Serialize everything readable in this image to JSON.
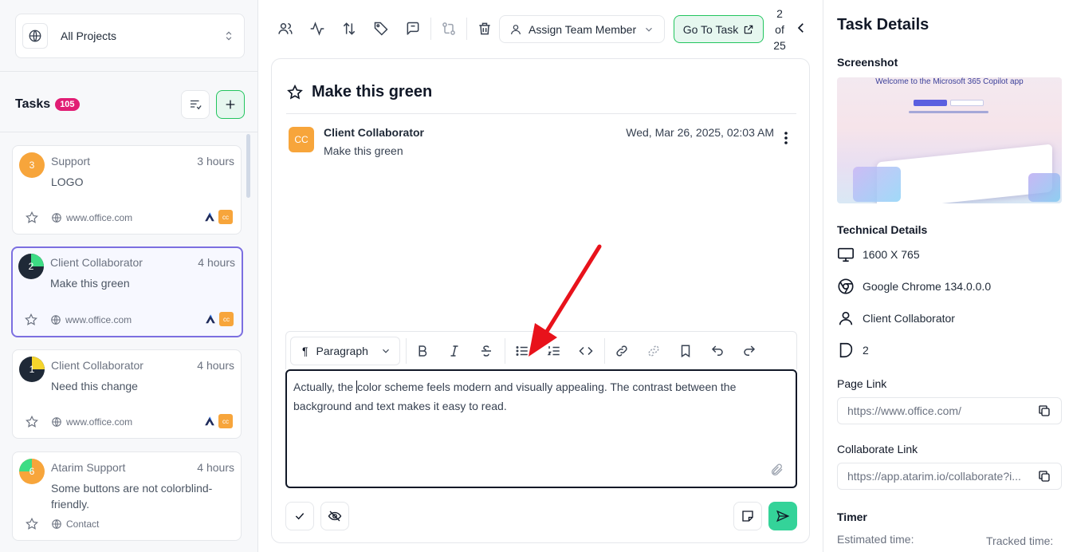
{
  "sidebar": {
    "project_select": "All Projects",
    "tasks_title": "Tasks",
    "tasks_count": "105",
    "tasks": [
      {
        "num": "3",
        "author": "Support",
        "time": "3 hours",
        "text": "LOGO",
        "site": "www.office.com"
      },
      {
        "num": "2",
        "author": "Client Collaborator",
        "time": "4 hours",
        "text": "Make this green",
        "site": "www.office.com"
      },
      {
        "num": "1",
        "author": "Client Collaborator",
        "time": "4 hours",
        "text": "Need this change",
        "site": "www.office.com"
      },
      {
        "num": "6",
        "author": "Atarim Support",
        "time": "4 hours",
        "text": "Some buttons are not colorblind-friendly.",
        "site": "Contact"
      }
    ],
    "avatar_initials": "cc"
  },
  "toolbar": {
    "assign_label": "Assign Team Member",
    "goto_label": "Go To Task",
    "pager": [
      "2",
      "of",
      "25"
    ]
  },
  "task": {
    "title": "Make this green",
    "comment": {
      "avatar": "CC",
      "author": "Client Collaborator",
      "date": "Wed, Mar 26, 2025, 02:03 AM",
      "text": "Make this green"
    },
    "editor": {
      "block_type": "Paragraph",
      "text_before_caret": "Actually, the ",
      "text_after_caret": "color scheme feels modern and visually appealing. The contrast between the background and text makes it easy to read."
    }
  },
  "details": {
    "title": "Task Details",
    "screenshot_label": "Screenshot",
    "screenshot_caption": "Welcome to the Microsoft 365 Copilot app",
    "technical_label": "Technical Details",
    "resolution": "1600 X 765",
    "browser": "Google Chrome 134.0.0.0",
    "user": "Client Collaborator",
    "task_number": "2",
    "page_link_label": "Page Link",
    "page_link": "https://www.office.com/",
    "collab_link_label": "Collaborate Link",
    "collab_link": "https://app.atarim.io/collaborate?i...",
    "timer_label": "Timer",
    "estimated_label": "Estimated time:",
    "tracked_label": "Tracked time:"
  },
  "colors": {
    "accent_green": "#22c55e",
    "badge_pink": "#e11d74",
    "avatar_orange": "#f7a53b",
    "selected_border": "#7c6fe0",
    "arrow_red": "#e8121b"
  }
}
